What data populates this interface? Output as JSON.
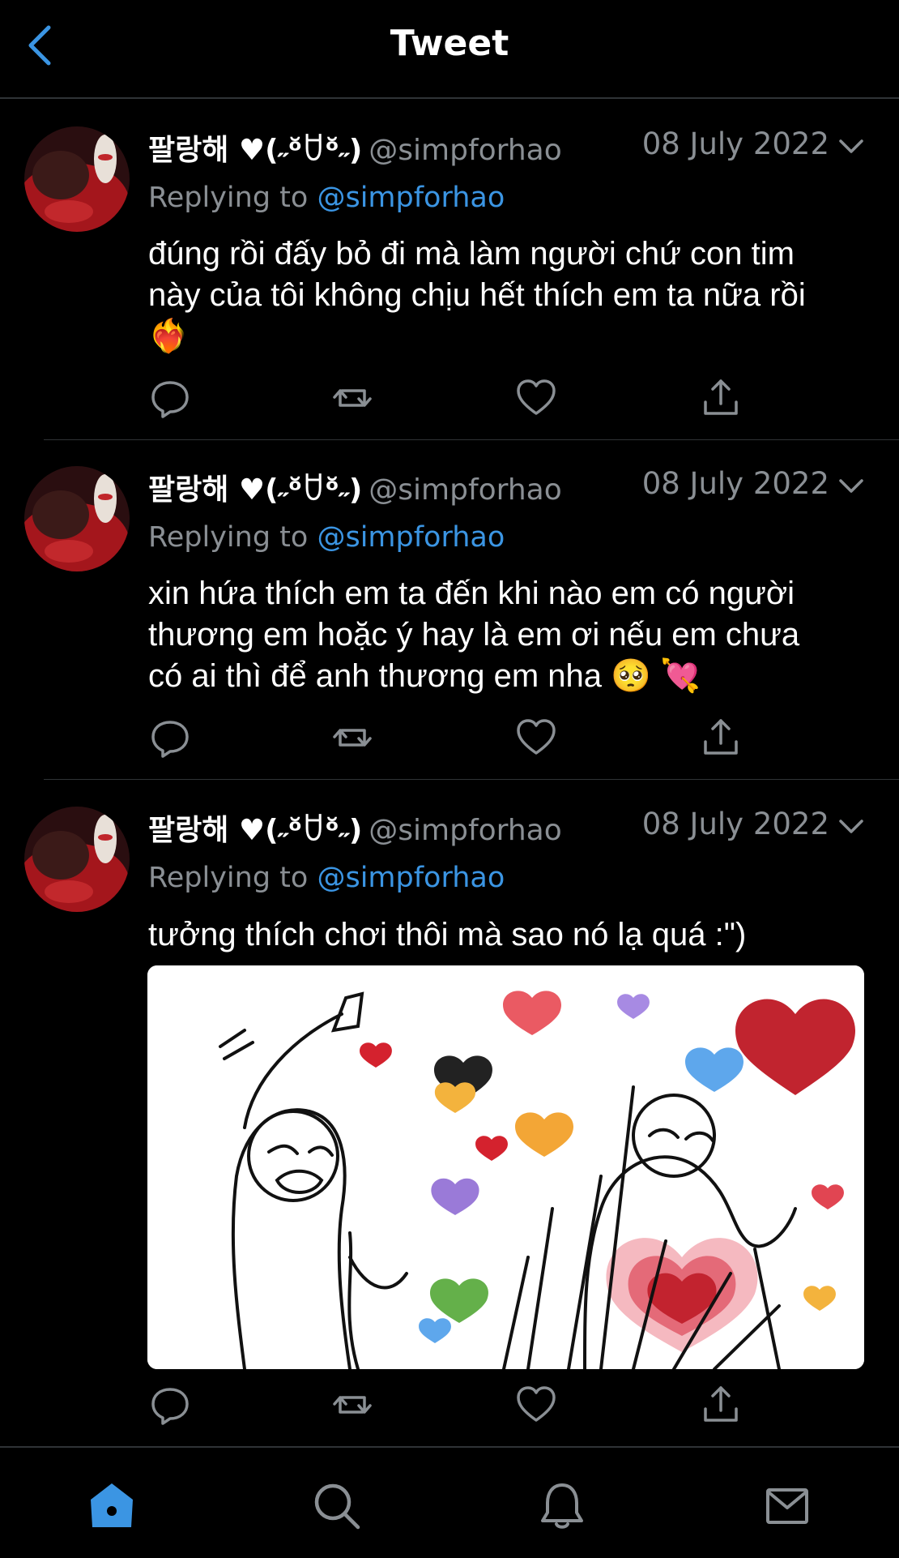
{
  "header": {
    "title": "Tweet"
  },
  "colors": {
    "accent": "#3b95e3",
    "muted": "#8a8f94",
    "background": "#000000",
    "divider": "#2f3336"
  },
  "tweets": [
    {
      "display_name": "팔랑해 ♥(˶ᵒ̆ꇴᵒ̆˶)",
      "handle": "@simpforhao",
      "date": "08 July 2022",
      "replying_prefix": "Replying to",
      "replying_to": "@simpforhao",
      "text_lines": [
        "đúng rồi đấy bỏ đi mà làm người chứ con tim",
        "này của tôi không chịu hết thích em ta nữa rồi",
        "❤️‍🔥"
      ]
    },
    {
      "display_name": "팔랑해 ♥(˶ᵒ̆ꇴᵒ̆˶)",
      "handle": "@simpforhao",
      "date": "08 July 2022",
      "replying_prefix": "Replying to",
      "replying_to": "@simpforhao",
      "text_lines": [
        "xin hứa thích em ta đến khi nào em có người",
        "thương em hoặc ý hay là em ơi nếu em chưa",
        "có ai thì để anh thương em nha 🥺 💘"
      ]
    },
    {
      "display_name": "팔랑해 ♥(˶ᵒ̆ꇴᵒ̆˶)",
      "handle": "@simpforhao",
      "date": "08 July 2022",
      "replying_prefix": "Replying to",
      "replying_to": "@simpforhao",
      "text_lines": [
        "tưởng thích chơi thôi mà sao nó lạ quá :\")"
      ],
      "has_image": true
    }
  ],
  "action_icons": [
    "reply-icon",
    "retweet-icon",
    "like-icon",
    "share-icon"
  ],
  "bottom_nav": [
    {
      "name": "home-icon",
      "active": true
    },
    {
      "name": "search-icon",
      "active": false
    },
    {
      "name": "notifications-icon",
      "active": false
    },
    {
      "name": "messages-icon",
      "active": false
    }
  ]
}
